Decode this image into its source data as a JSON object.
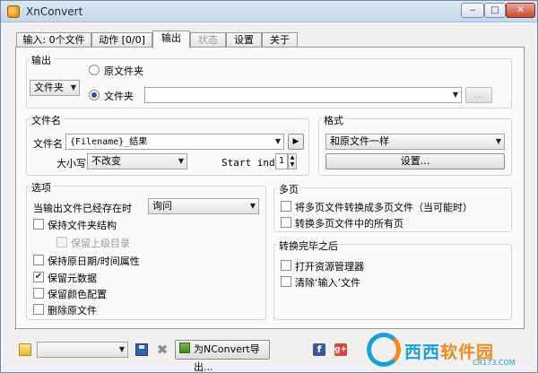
{
  "window": {
    "title": "XnConvert"
  },
  "tabs": [
    {
      "label": "输入: 0个文件",
      "state": "normal"
    },
    {
      "label": "动作 [0/0]",
      "state": "normal"
    },
    {
      "label": "输出",
      "state": "active"
    },
    {
      "label": "状态",
      "state": "disabled"
    },
    {
      "label": "设置",
      "state": "normal"
    },
    {
      "label": "关于",
      "state": "normal"
    }
  ],
  "output": {
    "group_label": "输出",
    "type_select": "文件夹",
    "radio_original": "原文件夹",
    "radio_folder": "文件夹",
    "selected_radio": "folder",
    "folder_path": "",
    "browse_label": "..."
  },
  "filename": {
    "group_label": "文件名",
    "name_label": "文件名",
    "name_value": "{Filename}_结果",
    "case_label": "大小写",
    "case_value": "不改变",
    "start_index_label": "Start index",
    "start_index_value": "1"
  },
  "format": {
    "group_label": "格式",
    "format_value": "和原文件一样",
    "settings_label": "设置..."
  },
  "options": {
    "group_label": "选项",
    "exists_label": "当输出文件已经存在时",
    "exists_value": "询问",
    "keep_folder_structure": {
      "label": "保持文件夹结构",
      "checked": false
    },
    "keep_parent_dir": {
      "label": "保留上级目录",
      "checked": false,
      "disabled": true
    },
    "keep_datetime": {
      "label": "保持原日期/时间属性",
      "checked": false
    },
    "keep_metadata": {
      "label": "保留元数据",
      "checked": true
    },
    "keep_color_profile": {
      "label": "保留颜色配置",
      "checked": false
    },
    "delete_original": {
      "label": "删除原文件",
      "checked": false
    }
  },
  "multipage": {
    "group_label": "多页",
    "to_multipage": {
      "label": "将多页文件转换成多页文件（当可能时）",
      "checked": false
    },
    "all_pages": {
      "label": "转换多页文件中的所有页",
      "checked": false
    }
  },
  "after": {
    "group_label": "转换完毕之后",
    "open_explorer": {
      "label": "打开资源管理器",
      "checked": false
    },
    "clear_input": {
      "label": "清除‘输入’文件",
      "checked": false
    }
  },
  "bottom": {
    "preset_value": "",
    "export_label": "为NConvert导出..."
  },
  "watermark": {
    "text_a": "西西",
    "text_b": "软件园",
    "url": "CR173.COM"
  },
  "colors": {
    "accent": "#1f56a8",
    "titlebar": "#c4d7ec",
    "close": "#c74a34"
  }
}
